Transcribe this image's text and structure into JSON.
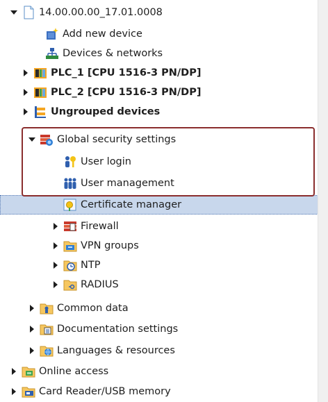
{
  "tree": {
    "project": {
      "label": "14.00.00.00_17.01.0008",
      "icon": "project-icon",
      "expanded": true
    },
    "items": [
      {
        "label": "Add new device",
        "icon": "add-device-icon"
      },
      {
        "label": "Devices & networks",
        "icon": "network-icon"
      },
      {
        "label": "PLC_1 [CPU 1516-3 PN/DP]",
        "icon": "plc-icon",
        "bold": true
      },
      {
        "label": "PLC_2 [CPU 1516-3 PN/DP]",
        "icon": "plc-icon",
        "bold": true
      },
      {
        "label": "Ungrouped devices",
        "icon": "ungrouped-devices-icon",
        "bold": true
      },
      {
        "label": "Global security settings",
        "icon": "global-security-icon",
        "expanded": true
      },
      {
        "label": "User login",
        "icon": "user-login-icon"
      },
      {
        "label": "User management",
        "icon": "user-management-icon"
      },
      {
        "label": "Certificate manager",
        "icon": "certificate-icon",
        "selected": true
      },
      {
        "label": "Firewall",
        "icon": "firewall-icon"
      },
      {
        "label": "VPN groups",
        "icon": "vpn-icon"
      },
      {
        "label": "NTP",
        "icon": "ntp-icon"
      },
      {
        "label": "RADIUS",
        "icon": "radius-icon"
      },
      {
        "label": "Common data",
        "icon": "common-data-icon"
      },
      {
        "label": "Documentation settings",
        "icon": "documentation-icon"
      },
      {
        "label": "Languages & resources",
        "icon": "languages-icon"
      },
      {
        "label": "Online access",
        "icon": "online-access-icon"
      },
      {
        "label": "Card Reader/USB memory",
        "icon": "card-reader-icon"
      }
    ]
  },
  "colors": {
    "selection": "#c8d7ec",
    "highlight_border": "#8a2d2d"
  }
}
